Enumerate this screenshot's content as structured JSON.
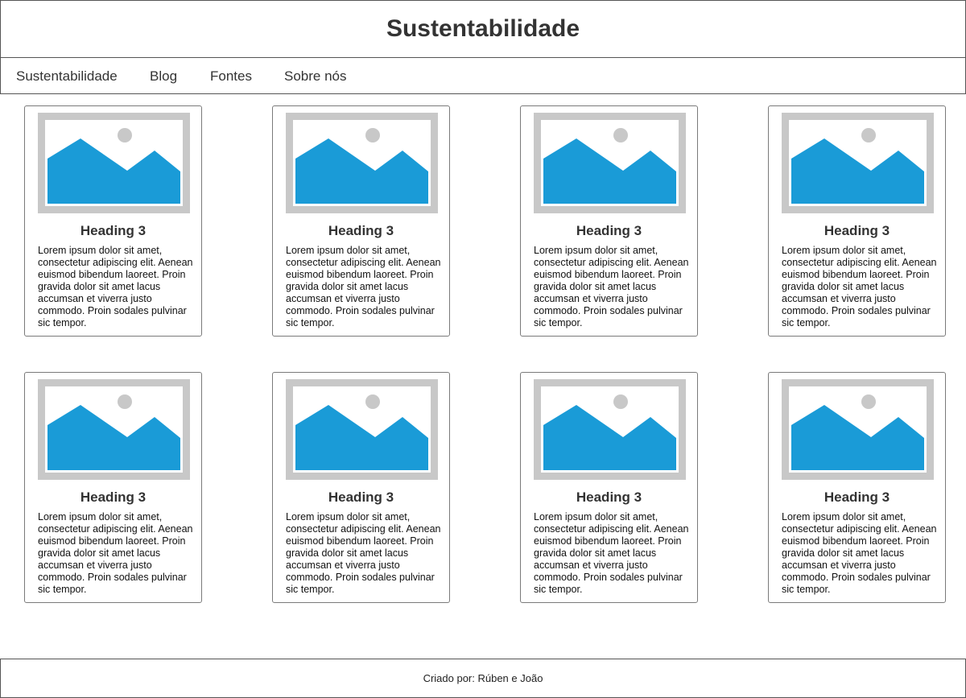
{
  "header": {
    "title": "Sustentabilidade"
  },
  "nav": {
    "items": [
      {
        "label": "Sustentabilidade"
      },
      {
        "label": "Blog"
      },
      {
        "label": "Fontes"
      },
      {
        "label": "Sobre nós"
      }
    ]
  },
  "cards": [
    {
      "heading": "Heading 3",
      "text": "Lorem ipsum dolor sit amet, consectetur adipiscing elit. Aenean euismod bibendum laoreet. Proin gravida dolor sit amet lacus accumsan et viverra justo commodo. Proin sodales pulvinar sic tempor."
    },
    {
      "heading": "Heading 3",
      "text": "Lorem ipsum dolor sit amet, consectetur adipiscing elit. Aenean euismod bibendum laoreet. Proin gravida dolor sit amet lacus accumsan et viverra justo commodo. Proin sodales pulvinar sic tempor."
    },
    {
      "heading": "Heading 3",
      "text": "Lorem ipsum dolor sit amet, consectetur adipiscing elit. Aenean euismod bibendum laoreet. Proin gravida dolor sit amet lacus accumsan et viverra justo commodo. Proin sodales pulvinar sic tempor."
    },
    {
      "heading": "Heading 3",
      "text": "Lorem ipsum dolor sit amet, consectetur adipiscing elit. Aenean euismod bibendum laoreet. Proin gravida dolor sit amet lacus accumsan et viverra justo commodo. Proin sodales pulvinar sic tempor."
    },
    {
      "heading": "Heading 3",
      "text": "Lorem ipsum dolor sit amet, consectetur adipiscing elit. Aenean euismod bibendum laoreet. Proin gravida dolor sit amet lacus accumsan et viverra justo commodo. Proin sodales pulvinar sic tempor."
    },
    {
      "heading": "Heading 3",
      "text": "Lorem ipsum dolor sit amet, consectetur adipiscing elit. Aenean euismod bibendum laoreet. Proin gravida dolor sit amet lacus accumsan et viverra justo commodo. Proin sodales pulvinar sic tempor."
    },
    {
      "heading": "Heading 3",
      "text": "Lorem ipsum dolor sit amet, consectetur adipiscing elit. Aenean euismod bibendum laoreet. Proin gravida dolor sit amet lacus accumsan et viverra justo commodo. Proin sodales pulvinar sic tempor."
    },
    {
      "heading": "Heading 3",
      "text": "Lorem ipsum dolor sit amet, consectetur adipiscing elit. Aenean euismod bibendum laoreet. Proin gravida dolor sit amet lacus accumsan et viverra justo commodo. Proin sodales pulvinar sic tempor."
    }
  ],
  "placeholder_image": {
    "icon": "image-placeholder-icon",
    "frame_color": "#c8c8c8",
    "mountain_color": "#1a9bd7",
    "sun_color": "#c8c8c8"
  },
  "footer": {
    "text": "Criado por: Rúben e João"
  }
}
